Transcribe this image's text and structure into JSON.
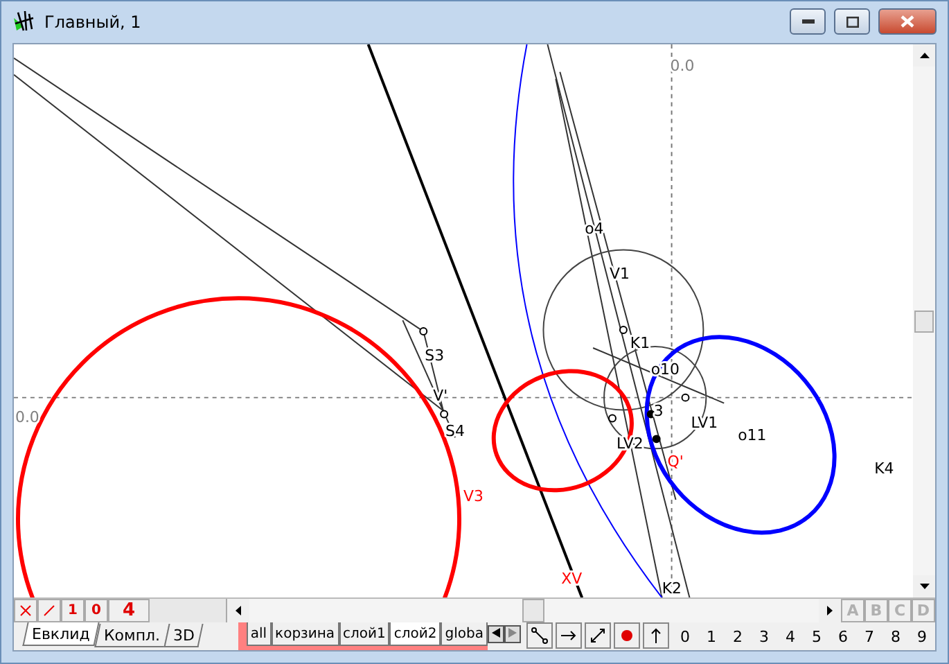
{
  "window": {
    "title": "Главный, 1"
  },
  "canvas": {
    "labels": [
      {
        "text": "0.0",
        "color": "#808080"
      },
      {
        "text": "0.0",
        "color": "#808080"
      },
      {
        "text": "S3",
        "color": "#000000"
      },
      {
        "text": "V'",
        "color": "#000000"
      },
      {
        "text": "S4",
        "color": "#000000"
      },
      {
        "text": "V3",
        "color": "#ff0000"
      },
      {
        "text": "o4",
        "color": "#000000"
      },
      {
        "text": "V1",
        "color": "#000000"
      },
      {
        "text": "K1",
        "color": "#000000"
      },
      {
        "text": "o10",
        "color": "#000000"
      },
      {
        "text": "3",
        "color": "#000000"
      },
      {
        "text": "LV1",
        "color": "#000000"
      },
      {
        "text": "LV2",
        "color": "#000000"
      },
      {
        "text": "Q'",
        "color": "#ff0000"
      },
      {
        "text": "o11",
        "color": "#000000"
      },
      {
        "text": "K4",
        "color": "#000000"
      },
      {
        "text": "XV",
        "color": "#ff0000"
      },
      {
        "text": "K2",
        "color": "#000000"
      }
    ]
  },
  "mode_buttons": [
    {
      "kind": "cross"
    },
    {
      "kind": "slash"
    },
    {
      "kind": "text",
      "text": "1"
    },
    {
      "kind": "text",
      "text": "0"
    },
    {
      "kind": "text",
      "text": "4"
    }
  ],
  "letter_buttons": [
    {
      "text": "A",
      "disabled": true
    },
    {
      "text": "B",
      "disabled": true
    },
    {
      "text": "C",
      "disabled": true
    },
    {
      "text": "D",
      "disabled": true
    }
  ],
  "view_tabs": [
    {
      "label": "Евклид",
      "selected": true
    },
    {
      "label": "Компл.",
      "selected": false
    },
    {
      "label": "3D",
      "selected": false
    }
  ],
  "layer_tabs": [
    {
      "label": "all",
      "selected": false
    },
    {
      "label": "корзина",
      "selected": false
    },
    {
      "label": "слой1",
      "selected": false
    },
    {
      "label": "слой2",
      "selected": true
    },
    {
      "label": "globa",
      "selected": false
    }
  ],
  "tools": [
    {
      "kind": "segment"
    },
    {
      "kind": "arrow"
    },
    {
      "kind": "diagonal"
    },
    {
      "kind": "point"
    },
    {
      "kind": "up"
    }
  ],
  "digits": [
    "0",
    "1",
    "2",
    "3",
    "4",
    "5",
    "6",
    "7",
    "8",
    "9"
  ]
}
